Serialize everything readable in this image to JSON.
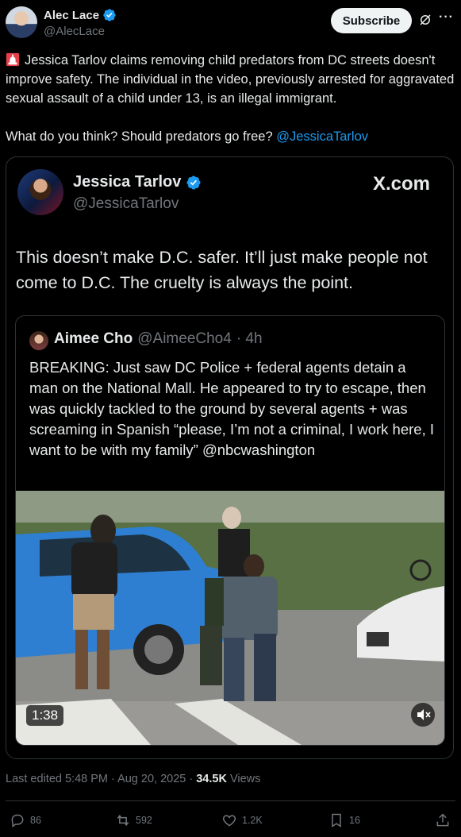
{
  "author": {
    "name": "Alec Lace",
    "handle": "@AlecLace",
    "subscribe_label": "Subscribe"
  },
  "tweet": {
    "emoji_icon": "police-siren-icon",
    "text_main": "Jessica Tarlov claims removing child predators from DC streets doesn't improve safety. The individual in the video, previously arrested for aggravated sexual assault of a child under 13, is an illegal immigrant.",
    "text_question": "What do you think? Should predators go free?",
    "mention": "@JessicaTarlov"
  },
  "quoted": {
    "name": "Jessica Tarlov",
    "handle": "@JessicaTarlov",
    "source": "X.com",
    "text": "This doesn’t make D.C. safer. It’ll just make people not come to D.C. The cruelty is always the point.",
    "inner": {
      "name": "Aimee Cho",
      "handle": "@AimeeCho4",
      "time": "· 4h",
      "text": "BREAKING: Just saw DC Police + federal agents detain a man on the National Mall. He appeared to try to escape, then was quickly tackled to the ground by several agents + was screaming in Spanish “please, I’m not a criminal, I work here, I want to be with my family” @nbcwashington",
      "video_duration": "1:38"
    }
  },
  "meta": {
    "edited": "Last edited 5:48 PM · Aug 20, 2025 ·",
    "views_count": "34.5K",
    "views_label": "Views"
  },
  "actions": {
    "replies": "86",
    "reposts": "592",
    "likes": "1.2K",
    "bookmarks": "16"
  },
  "colors": {
    "background": "#000000",
    "accent": "#1d9bf0",
    "text": "#e7e9ea",
    "muted": "#71767b",
    "border": "#2f3336"
  }
}
